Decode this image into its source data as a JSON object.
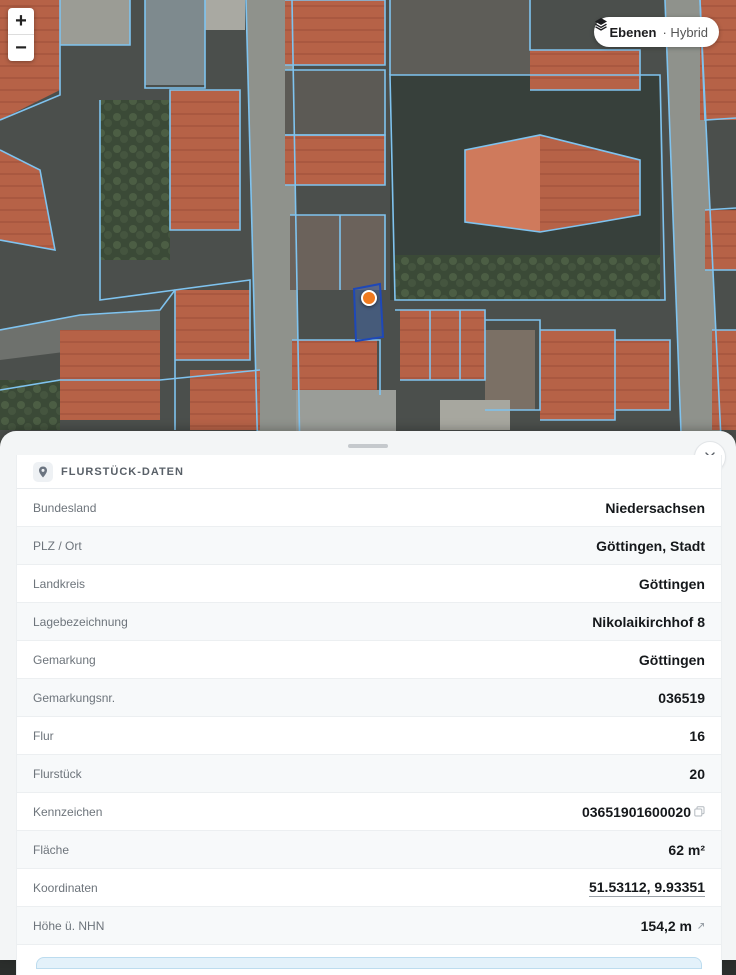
{
  "map": {
    "zoom_in_label": "+",
    "zoom_out_label": "−",
    "layers_label": "Ebenen",
    "layers_mode": "· Hybrid",
    "marker_color": "#f07a1f",
    "parcel_outline_color": "#7fc3ef",
    "selected_parcel_color": "#1e48b8",
    "icons": {
      "layers": "layers-icon",
      "marker": "location-marker-icon"
    }
  },
  "sheet": {
    "title": "FLURSTÜCK-DATEN",
    "icons": {
      "header": "pin-icon",
      "close": "close-icon",
      "copy": "copy-icon",
      "external": "external-link-icon"
    },
    "rows": [
      {
        "label": "Bundesland",
        "value": "Niedersachsen"
      },
      {
        "label": "PLZ / Ort",
        "value": "Göttingen, Stadt"
      },
      {
        "label": "Landkreis",
        "value": "Göttingen"
      },
      {
        "label": "Lagebezeichnung",
        "value": "Nikolaikirchhof 8"
      },
      {
        "label": "Gemarkung",
        "value": "Göttingen"
      },
      {
        "label": "Gemarkungsnr.",
        "value": "036519"
      },
      {
        "label": "Flur",
        "value": "16"
      },
      {
        "label": "Flurstück",
        "value": "20"
      },
      {
        "label": "Kennzeichen",
        "value": "03651901600020"
      },
      {
        "label": "Fläche",
        "value": "62 m²"
      },
      {
        "label": "Koordinaten",
        "value": "51.53112, 9.93351"
      },
      {
        "label": "Höhe ü. NHN",
        "value": "154,2 m"
      }
    ]
  }
}
